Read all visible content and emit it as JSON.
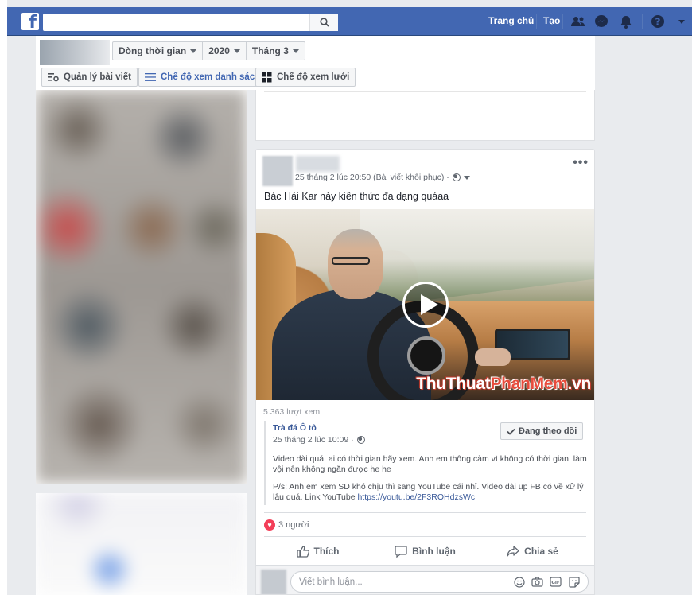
{
  "topbar": {
    "logo": "f",
    "nav_home": "Trang chủ",
    "nav_create": "Tạo"
  },
  "header": {
    "filters": [
      "Dòng thời gian",
      "2020",
      "Tháng 3"
    ],
    "manage_posts": "Quản lý bài viết",
    "list_view": "Chế độ xem danh sách",
    "grid_view": "Chế độ xem lưới"
  },
  "post": {
    "meta": "25 tháng 2 lúc 20:50 (Bài viết khôi phục) ·",
    "more": "•••",
    "text": "Bác Hải Kar này kiến thức đa dạng quáaa",
    "watermark_a": "ThuThuat",
    "watermark_b": "PhanMem",
    "watermark_c": ".vn",
    "views": "5.363 lượt xem",
    "shared": {
      "name": "Trà đá Ô tô",
      "time": "25 tháng 2 lúc 10:09 ·",
      "follow": "Đang theo dõi",
      "p1": "Video dài quá, ai có thời gian hãy xem. Anh em thông cảm vì không có thời gian, làm vội nên không ngắn được he he",
      "p2": "P/s: Anh em xem SD khó chịu thì sang YouTube cái nhỉ. Video dài up FB có về xử lý lâu quá. Link YouTube",
      "link": "https://youtu.be/2F3ROHdzsWc"
    },
    "reactions": "3 người",
    "like": "Thích",
    "comment": "Bình luận",
    "share": "Chia sẻ",
    "comment_placeholder": "Viết bình luận..."
  },
  "colors": {
    "brand": "#4267b2",
    "link": "#385898",
    "heart": "#f33e58"
  }
}
